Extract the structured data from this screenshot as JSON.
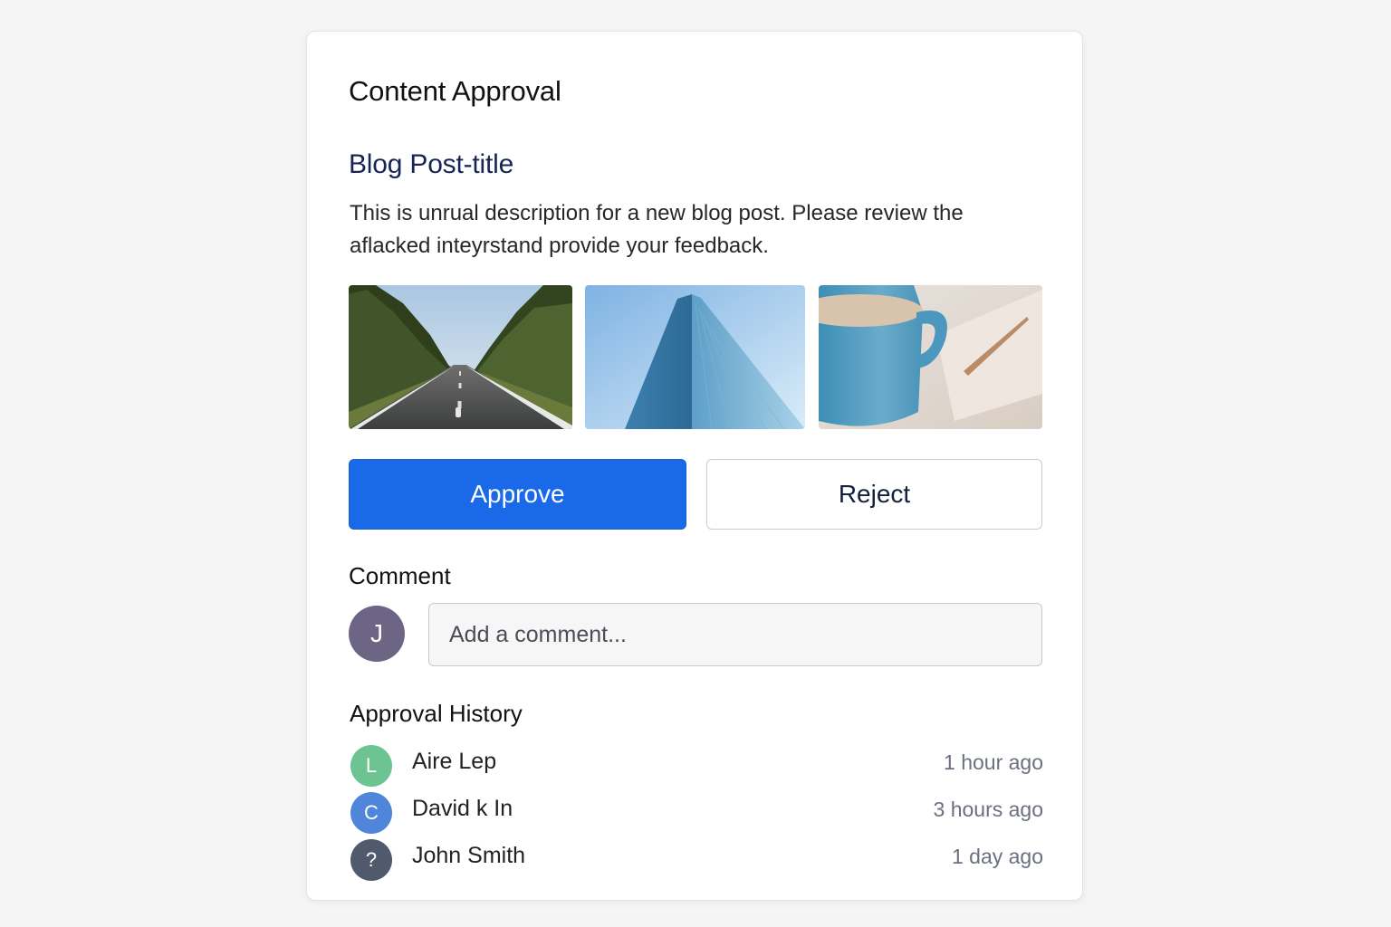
{
  "page": {
    "title": "Content Approval"
  },
  "post": {
    "title": "Blog Post-title",
    "description": "This is unrual description for a new blog post. Please review the aflacked inteyrstand provide your feedback.",
    "images": [
      {
        "subject": "road-through-trees"
      },
      {
        "subject": "glass-skyscraper"
      },
      {
        "subject": "coffee-mug-and-notebook"
      }
    ]
  },
  "actions": {
    "approve_label": "Approve",
    "reject_label": "Reject",
    "approve_color": "#1a69e8"
  },
  "comment": {
    "label": "Comment",
    "avatar_initial": "J",
    "avatar_color": "#6d6584",
    "placeholder": "Add a comment...",
    "value": ""
  },
  "history": {
    "label": "Approval History",
    "entries": [
      {
        "name": "Aire Lep",
        "time": "1 hour ago",
        "avatar_initial": "L",
        "avatar_color": "#6cc492"
      },
      {
        "name": "David k In",
        "time": "3 hours ago",
        "avatar_initial": "C",
        "avatar_color": "#4f86d9"
      },
      {
        "name": "John Smith",
        "time": "1 day ago",
        "avatar_initial": "?",
        "avatar_color": "#515a6c"
      }
    ]
  }
}
